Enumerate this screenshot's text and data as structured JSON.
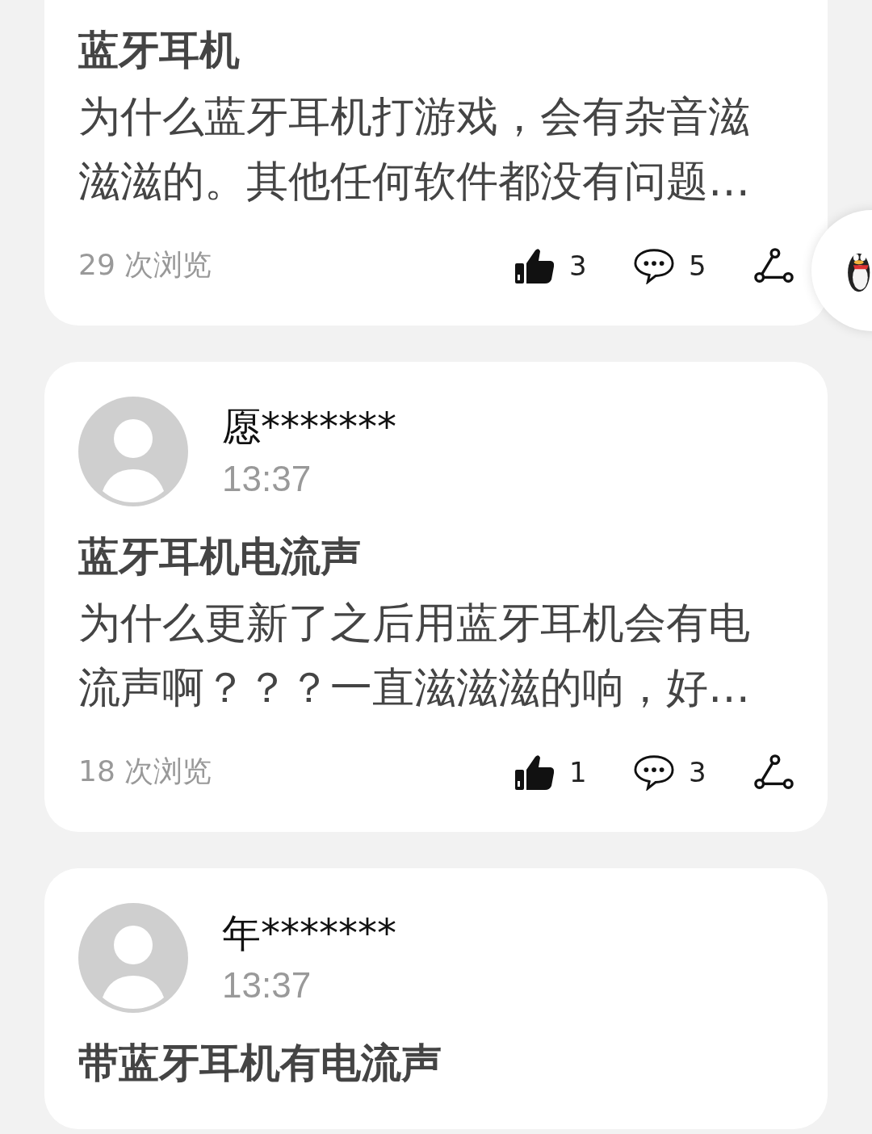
{
  "posts": [
    {
      "title": "蓝牙耳机",
      "body": "为什么蓝牙耳机打游戏，会有杂音滋滋滋的。其他任何软件都没有问题…",
      "views": "29 次浏览",
      "likes": "3",
      "comments": "5"
    },
    {
      "author": {
        "name": "愿*******",
        "time": "13:37"
      },
      "title": "蓝牙耳机电流声",
      "body": "为什么更新了之后用蓝牙耳机会有电流声啊？？？一直滋滋滋的响，好…",
      "views": "18 次浏览",
      "likes": "1",
      "comments": "3"
    },
    {
      "author": {
        "name": "年*******",
        "time": "13:37"
      },
      "title": "带蓝牙耳机有电流声"
    }
  ]
}
